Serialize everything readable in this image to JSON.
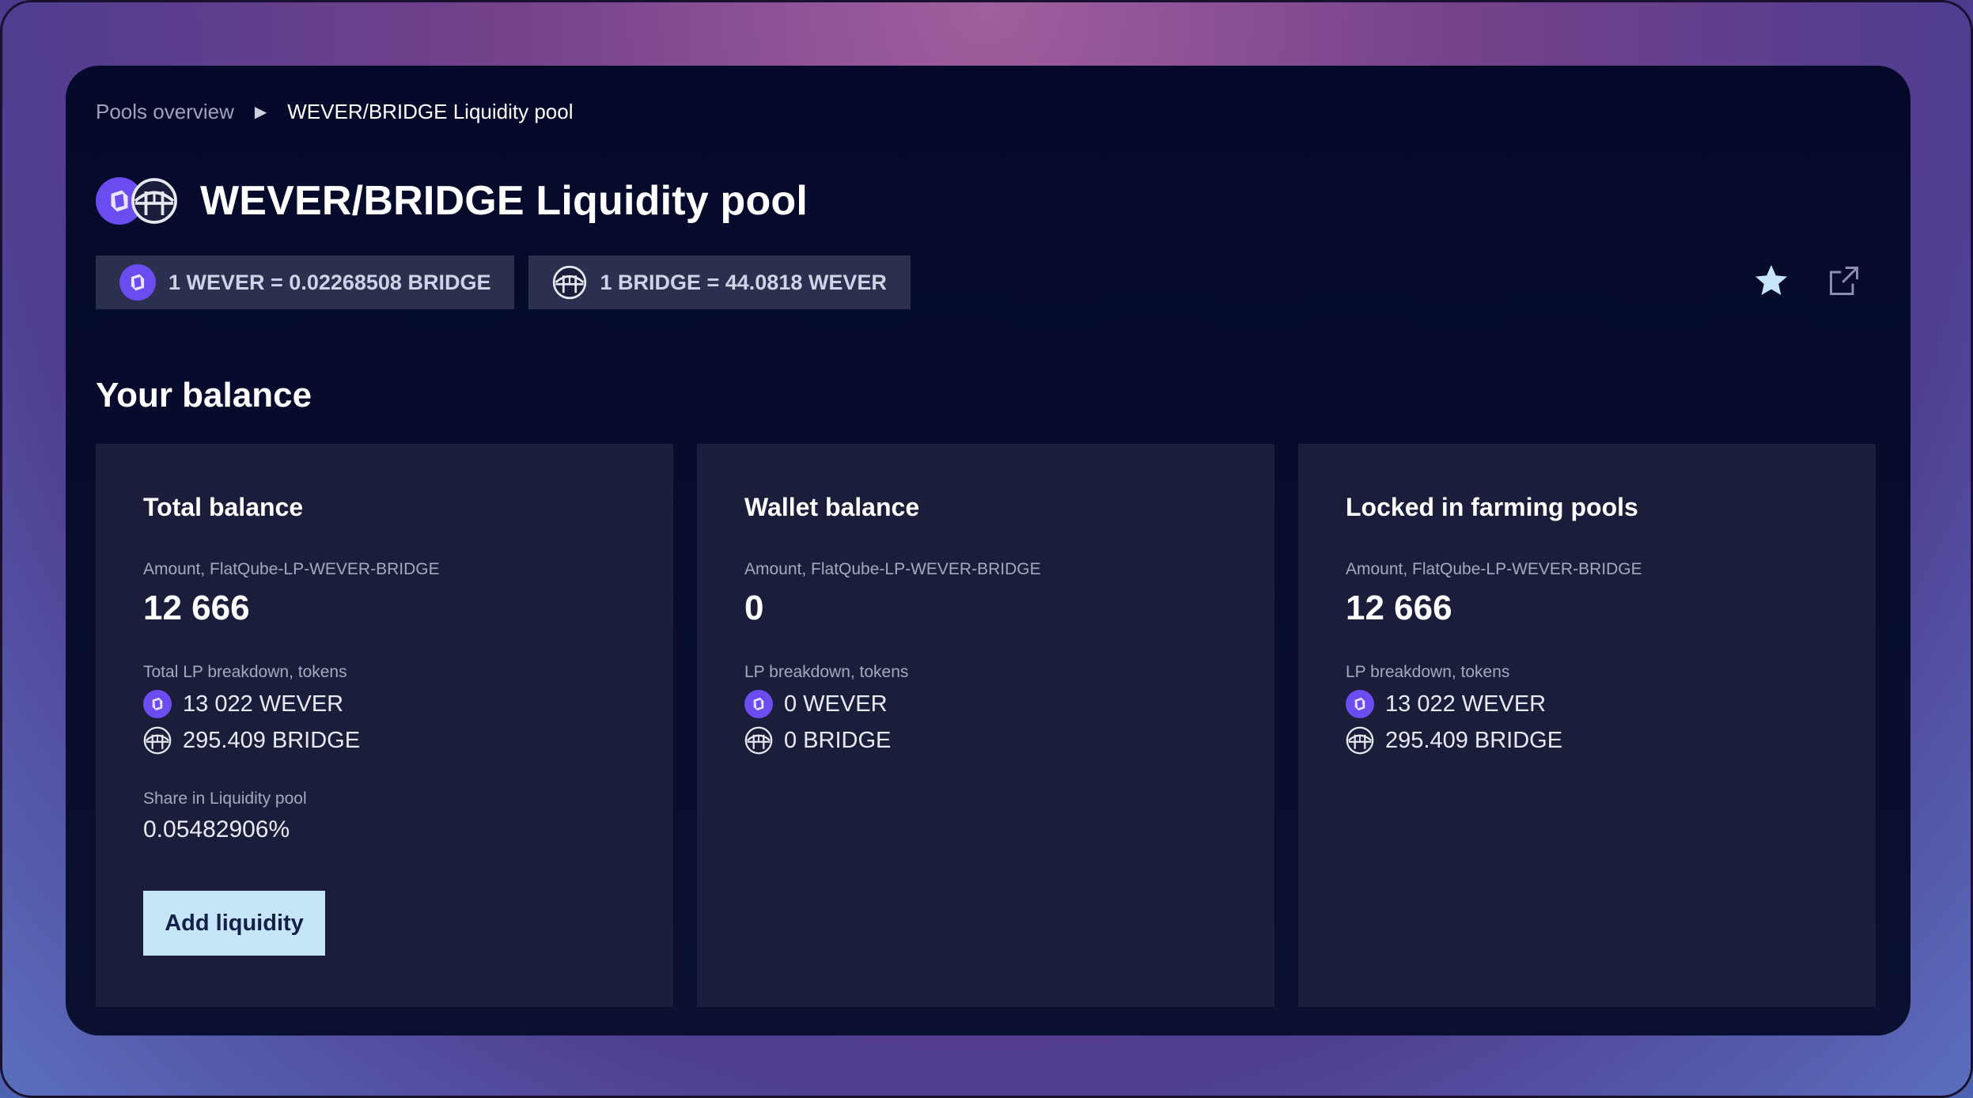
{
  "breadcrumb": {
    "root": "Pools overview",
    "current": "WEVER/BRIDGE Liquidity pool"
  },
  "header": {
    "title": "WEVER/BRIDGE Liquidity pool",
    "icons": [
      "wever-token-icon",
      "bridge-token-icon"
    ]
  },
  "rates": [
    {
      "icon": "wever-token-icon",
      "text": "1 WEVER = 0.02268508 BRIDGE"
    },
    {
      "icon": "bridge-token-icon",
      "text": "1 BRIDGE = 44.0818 WEVER"
    }
  ],
  "actions": {
    "favorite_icon": "star-icon",
    "external_icon": "external-link-icon"
  },
  "section": {
    "title": "Your balance"
  },
  "cards": [
    {
      "title": "Total balance",
      "amount_label": "Amount, FlatQube-LP-WEVER-BRIDGE",
      "amount": "12 666",
      "breakdown_label": "Total LP breakdown, tokens",
      "tokens": [
        "13 022 WEVER",
        "295.409 BRIDGE"
      ],
      "share_label": "Share in Liquidity pool",
      "share_value": "0.05482906%",
      "button_label": "Add liquidity"
    },
    {
      "title": "Wallet balance",
      "amount_label": "Amount, FlatQube-LP-WEVER-BRIDGE",
      "amount": "0",
      "breakdown_label": "LP breakdown, tokens",
      "tokens": [
        "0 WEVER",
        "0 BRIDGE"
      ]
    },
    {
      "title": "Locked in farming pools",
      "amount_label": "Amount, FlatQube-LP-WEVER-BRIDGE",
      "amount": "12 666",
      "breakdown_label": "LP breakdown, tokens",
      "tokens": [
        "13 022 WEVER",
        "295.409 BRIDGE"
      ]
    }
  ],
  "colors": {
    "panel_bg": "#050a2a",
    "card_bg": "#1b1e3a",
    "chip_bg": "#2a304e",
    "button_bg": "#c6e6f8",
    "wever_purple": "#6b4cf0",
    "star": "#c6e6f8"
  }
}
